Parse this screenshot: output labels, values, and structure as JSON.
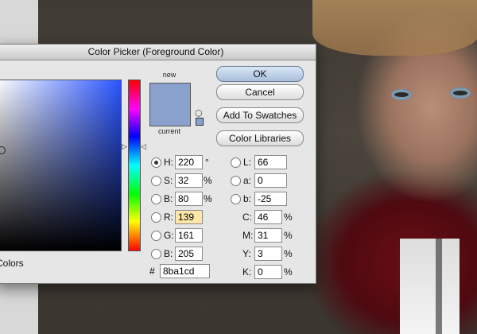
{
  "dialog": {
    "title": "Color Picker (Foreground Color)",
    "new_label": "new",
    "current_label": "current",
    "new_color": "#8ba1cd",
    "current_color": "#8ba1cd",
    "colors_label": "Colors",
    "buttons": {
      "ok": "OK",
      "cancel": "Cancel",
      "add_swatches": "Add To Swatches",
      "libraries": "Color Libraries"
    },
    "hsb": {
      "h": {
        "label": "H:",
        "value": "220",
        "unit": "°"
      },
      "s": {
        "label": "S:",
        "value": "32",
        "unit": "%"
      },
      "b": {
        "label": "B:",
        "value": "80",
        "unit": "%"
      }
    },
    "rgb": {
      "r": {
        "label": "R:",
        "value": "139"
      },
      "g": {
        "label": "G:",
        "value": "161"
      },
      "b": {
        "label": "B:",
        "value": "205"
      }
    },
    "lab": {
      "l": {
        "label": "L:",
        "value": "66"
      },
      "a": {
        "label": "a:",
        "value": "0"
      },
      "b": {
        "label": "b:",
        "value": "-25"
      }
    },
    "cmyk": {
      "c": {
        "label": "C:",
        "value": "46",
        "unit": "%"
      },
      "m": {
        "label": "M:",
        "value": "31",
        "unit": "%"
      },
      "y": {
        "label": "Y:",
        "value": "3",
        "unit": "%"
      },
      "k": {
        "label": "K:",
        "value": "0",
        "unit": "%"
      }
    },
    "hex": {
      "label": "#",
      "value": "8ba1cd"
    }
  }
}
